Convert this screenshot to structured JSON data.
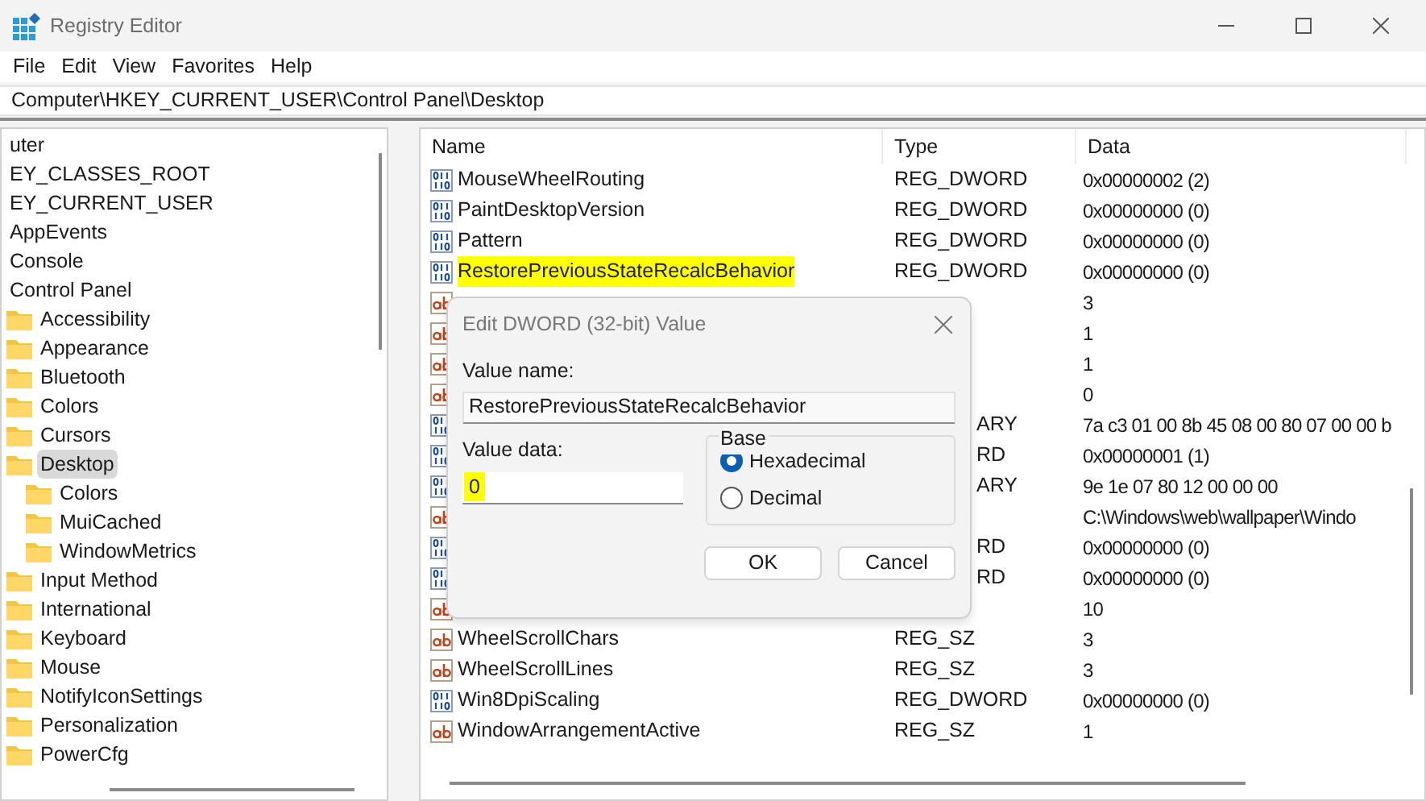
{
  "window": {
    "title": "Registry Editor"
  },
  "menu": [
    "File",
    "Edit",
    "View",
    "Favorites",
    "Help"
  ],
  "address": "Computer\\HKEY_CURRENT_USER\\Control Panel\\Desktop",
  "tree": [
    {
      "label": "uter",
      "selected": false,
      "children": [
        {
          "label": "EY_CLASSES_ROOT",
          "selected": false
        },
        {
          "label": "EY_CURRENT_USER",
          "selected": false,
          "children": [
            {
              "label": "AppEvents",
              "selected": false
            },
            {
              "label": "Console",
              "selected": false
            },
            {
              "label": "Control Panel",
              "selected": false,
              "children": [
                {
                  "label": "Accessibility",
                  "selected": false
                },
                {
                  "label": "Appearance",
                  "selected": false
                },
                {
                  "label": "Bluetooth",
                  "selected": false
                },
                {
                  "label": "Colors",
                  "selected": false
                },
                {
                  "label": "Cursors",
                  "selected": false
                },
                {
                  "label": "Desktop",
                  "selected": true,
                  "children": [
                    {
                      "label": "Colors",
                      "selected": false
                    },
                    {
                      "label": "MuiCached",
                      "selected": false
                    },
                    {
                      "label": "WindowMetrics",
                      "selected": false
                    }
                  ]
                },
                {
                  "label": "Input Method",
                  "selected": false
                },
                {
                  "label": "International",
                  "selected": false
                },
                {
                  "label": "Keyboard",
                  "selected": false
                },
                {
                  "label": "Mouse",
                  "selected": false
                },
                {
                  "label": "NotifyIconSettings",
                  "selected": false
                },
                {
                  "label": "Personalization",
                  "selected": false
                },
                {
                  "label": "PowerCfg",
                  "selected": false
                }
              ]
            }
          ]
        }
      ]
    }
  ],
  "columns": [
    "Name",
    "Type",
    "Data"
  ],
  "rows": [
    {
      "kind": "binary",
      "name": "MouseWheelRouting",
      "type": "REG_DWORD",
      "data": "0x00000002 (2)",
      "highlighted": false
    },
    {
      "kind": "binary",
      "name": "PaintDesktopVersion",
      "type": "REG_DWORD",
      "data": "0x00000000 (0)",
      "highlighted": false
    },
    {
      "kind": "binary",
      "name": "Pattern",
      "type": "REG_DWORD",
      "data": "0x00000000 (0)",
      "highlighted": false
    },
    {
      "kind": "binary",
      "name": "RestorePreviousStateRecalcBehavior",
      "type": "REG_DWORD",
      "data": "0x00000000 (0)",
      "highlighted": true
    },
    {
      "kind": "string",
      "data": "3",
      "highlighted": false
    },
    {
      "kind": "string",
      "data": "1",
      "highlighted": false
    },
    {
      "kind": "string",
      "data": "1",
      "highlighted": false
    },
    {
      "kind": "string",
      "data": "0",
      "highlighted": false
    },
    {
      "kind": "binary",
      "type": "ARY",
      "type_partial": true,
      "data": "7a c3 01 00 8b 45 08 00 80 07 00 00 b",
      "highlighted": false
    },
    {
      "kind": "binary",
      "type": "RD",
      "type_partial": true,
      "data": "0x00000001 (1)",
      "highlighted": false
    },
    {
      "kind": "binary",
      "type": "ARY",
      "type_partial": true,
      "data": "9e 1e 07 80 12 00 00 00",
      "highlighted": false
    },
    {
      "kind": "string",
      "data": "C:\\Windows\\web\\wallpaper\\Windo",
      "highlighted": false
    },
    {
      "kind": "binary",
      "type": "RD",
      "type_partial": true,
      "data": "0x00000000 (0)",
      "highlighted": false
    },
    {
      "kind": "binary",
      "type": "RD",
      "type_partial": true,
      "data": "0x00000000 (0)",
      "highlighted": false
    },
    {
      "kind": "string",
      "data": "10",
      "highlighted": false
    },
    {
      "kind": "string",
      "name": "WheelScrollChars",
      "type": "REG_SZ",
      "data": "3",
      "highlighted": false
    },
    {
      "kind": "string",
      "name": "WheelScrollLines",
      "type": "REG_SZ",
      "data": "3",
      "highlighted": false
    },
    {
      "kind": "binary",
      "name": "Win8DpiScaling",
      "type": "REG_DWORD",
      "data": "0x00000000 (0)",
      "highlighted": false
    },
    {
      "kind": "string",
      "name": "WindowArrangementActive",
      "type": "REG_SZ",
      "data": "1",
      "highlighted": false
    }
  ],
  "dialog": {
    "title": "Edit DWORD (32-bit) Value",
    "value_name_label": "Value name:",
    "value_name": "RestorePreviousStateRecalcBehavior",
    "value_data_label": "Value data:",
    "value_data": "0",
    "value_data_highlighted": true,
    "base_label": "Base",
    "bases": [
      {
        "label": "Hexadecimal",
        "selected": true
      },
      {
        "label": "Decimal",
        "selected": false
      }
    ],
    "buttons": [
      "OK",
      "Cancel"
    ]
  }
}
